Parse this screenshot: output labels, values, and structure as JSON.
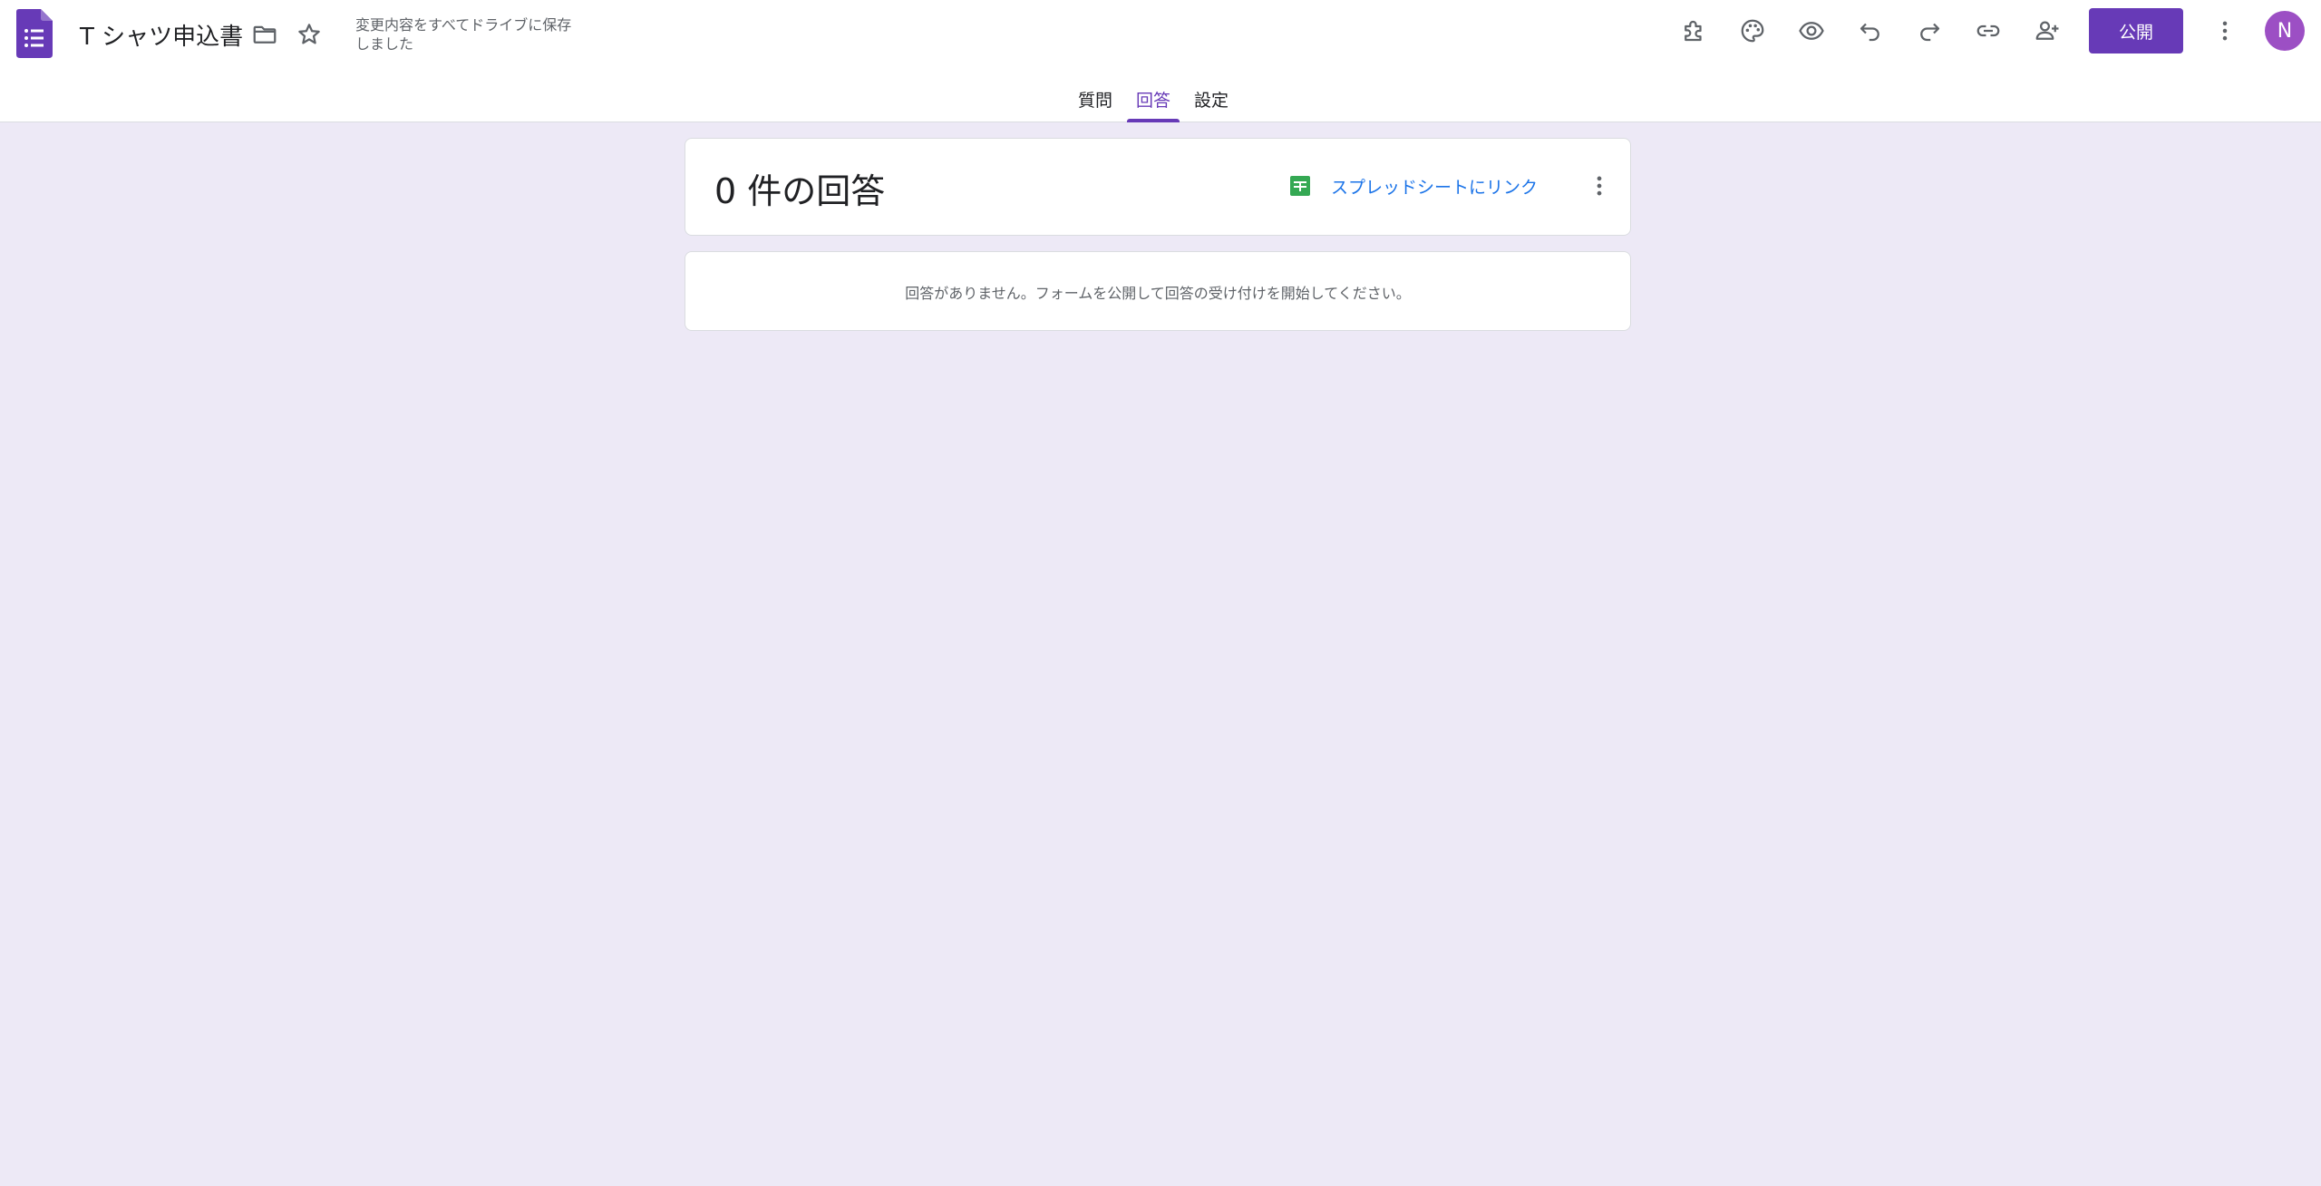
{
  "header": {
    "title": "T シャツ申込書",
    "save_status": "変更内容をすべてドライブに保存しました",
    "publish_label": "公開",
    "avatar_initial": "N",
    "icons": [
      "forms-logo-icon",
      "folder-icon",
      "star-icon",
      "addon-icon",
      "palette-icon",
      "preview-icon",
      "undo-icon",
      "redo-icon",
      "link-icon",
      "add-collaborator-icon",
      "more-vert-icon"
    ]
  },
  "tabs": [
    {
      "label": "質問",
      "active": false
    },
    {
      "label": "回答",
      "active": true
    },
    {
      "label": "設定",
      "active": false
    }
  ],
  "summary": {
    "response_count": "0 件の回答",
    "sheet_link_label": "スプレッドシートにリンク"
  },
  "empty": {
    "message": "回答がありません。フォームを公開して回答の受け付けを開始してください。"
  },
  "colors": {
    "brand": "#673ab7",
    "background": "#ede9f6",
    "link": "#1a73e8",
    "sheets_green": "#34a853",
    "avatar": "#9c4fc4"
  }
}
